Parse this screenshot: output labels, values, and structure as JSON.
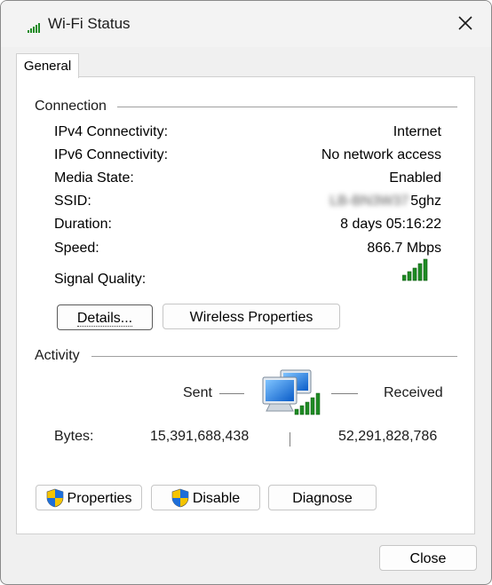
{
  "window": {
    "title": "Wi-Fi Status",
    "close_glyph": "✕"
  },
  "tabs": [
    {
      "label": "General",
      "active": true
    }
  ],
  "connection": {
    "heading": "Connection",
    "rows": [
      {
        "label": "IPv4 Connectivity:",
        "value": "Internet"
      },
      {
        "label": "IPv6 Connectivity:",
        "value": "No network access"
      },
      {
        "label": "Media State:",
        "value": "Enabled"
      },
      {
        "label": "SSID:",
        "value_hidden": "LB-BN3W37",
        "value": "5ghz"
      },
      {
        "label": "Duration:",
        "value": "8 days 05:16:22"
      },
      {
        "label": "Speed:",
        "value": "866.7 Mbps"
      }
    ],
    "signal_label": "Signal Quality:",
    "signal_bars": 5,
    "details_button": "Details...",
    "wireless_button": "Wireless Properties"
  },
  "activity": {
    "heading": "Activity",
    "sent_label": "Sent",
    "received_label": "Received",
    "bytes_label": "Bytes:",
    "sent_bytes": "15,391,688,438",
    "received_bytes": "52,291,828,786"
  },
  "buttons": {
    "properties": "Properties",
    "disable": "Disable",
    "diagnose": "Diagnose",
    "close": "Close"
  },
  "colors": {
    "signal": "#1f8b24",
    "accent": "#0067c0",
    "shield_blue": "#1e6ed8",
    "shield_yellow": "#f5c400"
  },
  "icons": {
    "title": "wifi-signal-icon",
    "network": "network-computers-icon",
    "shield": "uac-shield-icon"
  }
}
